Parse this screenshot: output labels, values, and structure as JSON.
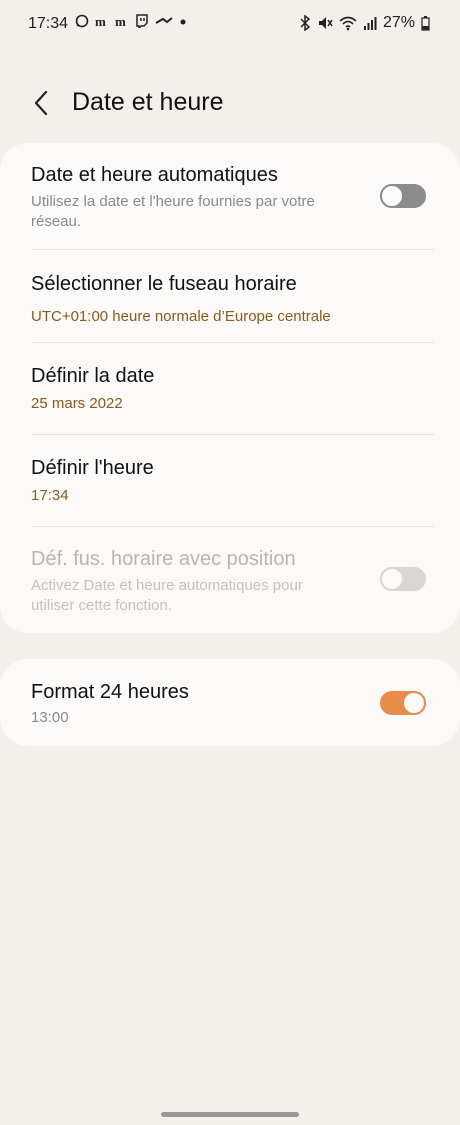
{
  "status_bar": {
    "time": "17:34",
    "battery": "27%",
    "notification_icons": [
      "whatsapp-icon",
      "m-icon",
      "m-icon",
      "twitch-icon",
      "swipe-icon",
      "dot-icon"
    ],
    "system_icons": [
      "bluetooth-icon",
      "mute-icon",
      "wifi-icon",
      "signal-icon",
      "battery-icon"
    ]
  },
  "header": {
    "title": "Date et heure"
  },
  "settings": {
    "auto_datetime": {
      "label": "Date et heure automatiques",
      "sub_line1": "Utilisez la date et l'heure fournies par votre",
      "sub_line2": "réseau.",
      "enabled": false
    },
    "timezone": {
      "label": "Sélectionner le fuseau horaire",
      "value": "UTC+01:00 heure normale d’Europe centrale"
    },
    "set_date": {
      "label": "Définir la date",
      "value": "25 mars 2022"
    },
    "set_time": {
      "label": "Définir l'heure",
      "value": "17:34"
    },
    "tz_by_location": {
      "label": "Déf. fus. horaire avec position",
      "sub_line1": "Activez Date et heure automatiques pour",
      "sub_line2": "utiliser cette fonction.",
      "enabled": false,
      "disabled": true
    },
    "format_24h": {
      "label": "Format 24 heures",
      "value": "13:00",
      "enabled": true
    }
  },
  "colors": {
    "accent_text": "#8a5a1c",
    "toggle_on": "#e78c4a",
    "background": "#f3efeb",
    "card": "#fbfaf9"
  }
}
